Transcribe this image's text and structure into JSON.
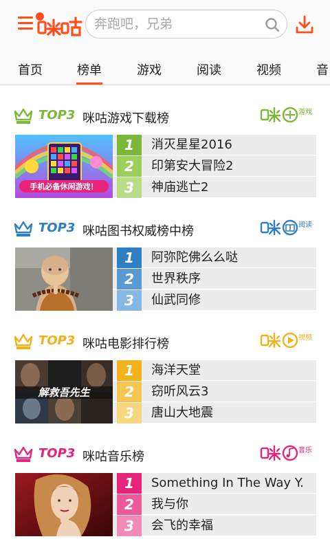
{
  "header": {
    "search_placeholder": "奔跑吧，兄弟",
    "accent": "#ff4d1c"
  },
  "tabs": [
    {
      "label": "首页"
    },
    {
      "label": "榜单"
    },
    {
      "label": "游戏"
    },
    {
      "label": "阅读"
    },
    {
      "label": "视频"
    },
    {
      "label": "音"
    }
  ],
  "active_tab": "榜单",
  "sections": [
    {
      "key": "game",
      "top3": "TOP3",
      "title": "咪咕游戏下载榜",
      "color": "#7ab83a",
      "badge_label": "游戏",
      "items": [
        {
          "rank": "1",
          "title": "消灭星星2016"
        },
        {
          "rank": "2",
          "title": "印第安大冒险2"
        },
        {
          "rank": "3",
          "title": "神庙逃亡2"
        }
      ],
      "thumb_caption": "手机必备休闲游戏！"
    },
    {
      "key": "read",
      "top3": "TOP3",
      "title": "咪咕图书权威榜中榜",
      "color": "#2f7fc4",
      "badge_label": "阅读",
      "items": [
        {
          "rank": "1",
          "title": "阿弥陀佛么么哒"
        },
        {
          "rank": "2",
          "title": "世界秩序"
        },
        {
          "rank": "3",
          "title": "仙武同修"
        }
      ]
    },
    {
      "key": "video",
      "top3": "TOP3",
      "title": "咪咕电影排行榜",
      "color": "#f2b21c",
      "badge_label": "视频",
      "items": [
        {
          "rank": "1",
          "title": "海洋天堂"
        },
        {
          "rank": "2",
          "title": "窃听风云3"
        },
        {
          "rank": "3",
          "title": "唐山大地震"
        }
      ],
      "thumb_caption": "解救吾先生"
    },
    {
      "key": "music",
      "top3": "TOP3",
      "title": "咪咕音乐榜",
      "color": "#e8247a",
      "badge_label": "音乐",
      "items": [
        {
          "rank": "1",
          "title": "Something In The Way Y."
        },
        {
          "rank": "2",
          "title": "我与你"
        },
        {
          "rank": "3",
          "title": "会飞的幸福"
        }
      ]
    }
  ]
}
